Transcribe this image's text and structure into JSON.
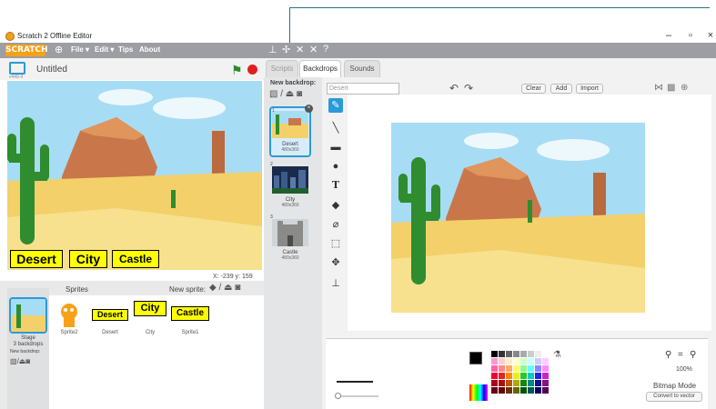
{
  "window": {
    "title": "Scratch 2 Offline Editor",
    "min": "–",
    "max": "▫",
    "close": "×"
  },
  "menubar": {
    "logo": "SCRATCH",
    "menus": [
      "File ▾",
      "Edit ▾",
      "Tips",
      "About"
    ]
  },
  "stage": {
    "project_title": "Untitled",
    "version": "v449.4",
    "buttons": [
      "Desert",
      "City",
      "Castle"
    ],
    "x_label": "X:",
    "x_value": "-239",
    "y_label": "y:",
    "y_value": "159"
  },
  "sprites": {
    "title": "Sprites",
    "new_sprite": "New sprite:",
    "stage_label": "Stage",
    "stage_sub": "3 backdrops",
    "new_backdrop": "New backdrop:",
    "items": [
      {
        "name": "Sprite2",
        "text": ""
      },
      {
        "name": "Desert",
        "text": "Desert"
      },
      {
        "name": "City",
        "text": "City"
      },
      {
        "name": "Sprite1",
        "text": "Castle"
      }
    ]
  },
  "editor": {
    "tabs": [
      "Scripts",
      "Backdrops",
      "Sounds"
    ],
    "active_tab": "Backdrops",
    "new_backdrop": "New backdrop:",
    "backdrop_name": "Desert",
    "clear": "Clear",
    "add": "Add",
    "import": "Import",
    "backdrops": [
      {
        "num": "1",
        "name": "Desert",
        "size": "480x360"
      },
      {
        "num": "2",
        "name": "City",
        "size": "480x360"
      },
      {
        "num": "3",
        "name": "Castle",
        "size": "480x360"
      }
    ],
    "zoom": "100%",
    "mode": "Bitmap Mode",
    "convert": "Convert to vector"
  },
  "colors": {
    "accent": "#2a9ad8",
    "menubar": "#9c9ea2",
    "label_bg": "#ffff00"
  }
}
